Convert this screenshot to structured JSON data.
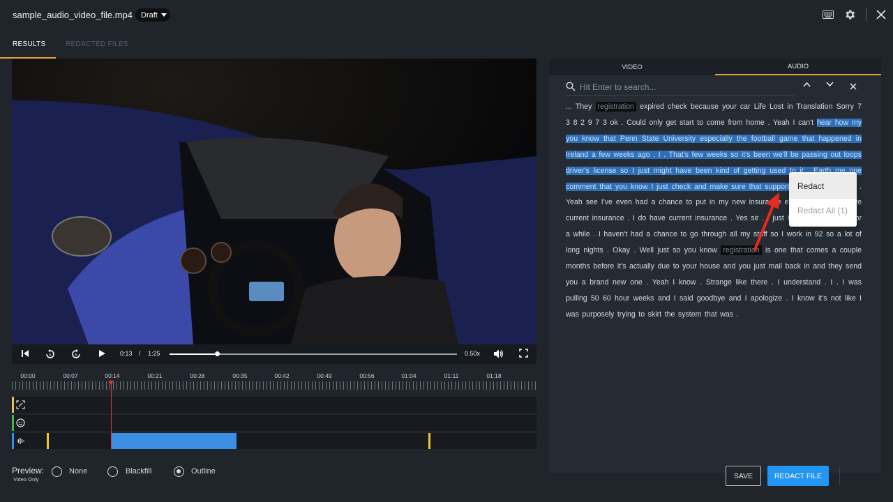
{
  "header": {
    "filename": "sample_audio_video_file.mp4",
    "status": "Draft",
    "icons": [
      "keyboard-icon",
      "gear-icon",
      "close-icon"
    ]
  },
  "tabs": [
    {
      "label": "RESULTS",
      "active": true
    },
    {
      "label": "REDACTED FILES",
      "active": false
    }
  ],
  "player": {
    "current_time": "0:13",
    "time_separator": "/",
    "duration": "1:25",
    "speed": "0.50x",
    "progress": 0.165
  },
  "timeline": {
    "labels": [
      "00:00",
      "00:07",
      "00:14",
      "00:21",
      "00:28",
      "00:35",
      "00:42",
      "00:49",
      "00:56",
      "01:04",
      "01:11",
      "01:18"
    ],
    "playhead_time": "00:14"
  },
  "preview": {
    "label": "Preview:",
    "sublabel": "Video Only",
    "options": [
      "None",
      "Blackfill",
      "Outline"
    ],
    "selected": "Outline"
  },
  "panel": {
    "tabs": [
      "VIDEO",
      "AUDIO"
    ],
    "active_tab": "AUDIO",
    "search_placeholder": "Hit Enter to search...",
    "transcript": {
      "p1": "... They",
      "kw1": "registration",
      "p2": "expired check because your car Life Lost in Translation Sorry 7 3 8 2 9 7 3 ok . Could only get start to come from home . Yeah I can't",
      "hl": "hear how my you know that Penn State University especially the football game that happened in Ireland a few weeks ago . I . That's few weeks so it's been we'll be passing out loops driver's license so I just might have been kind of getting used to it . Earth me one comment that you know I just check and make sure that support",
      "p3": "at home insurance . Yeah see I've even had a chance to put in my new insurance expires . Do you have current insurance . I do have current insurance . Yes sir . I just I back our country for a while . I haven't had a chance to go through all my stuff so I work in 92 so a lot of long nights . Okay . Well just so you know",
      "kw2": "registration",
      "p4": "is one that comes a couple months before it's actually due to your house and you just mail back in and they send you a brand new one . Yeah I know . Strange like there . I understand . I . I was pulling 50 60 hour weeks and I said goodbye and I apologize . I know it's not like I was purposely trying to skirt the system that was ."
    }
  },
  "context_menu": {
    "redact": "Redact",
    "redact_all": "Redact All (1)"
  },
  "buttons": {
    "save": "SAVE",
    "redact_file": "REDACT FILE"
  },
  "colors": {
    "accent": "#e8a33d",
    "highlight": "#2f6fb7",
    "primary_button": "#2196f3",
    "playhead": "#e53935"
  }
}
